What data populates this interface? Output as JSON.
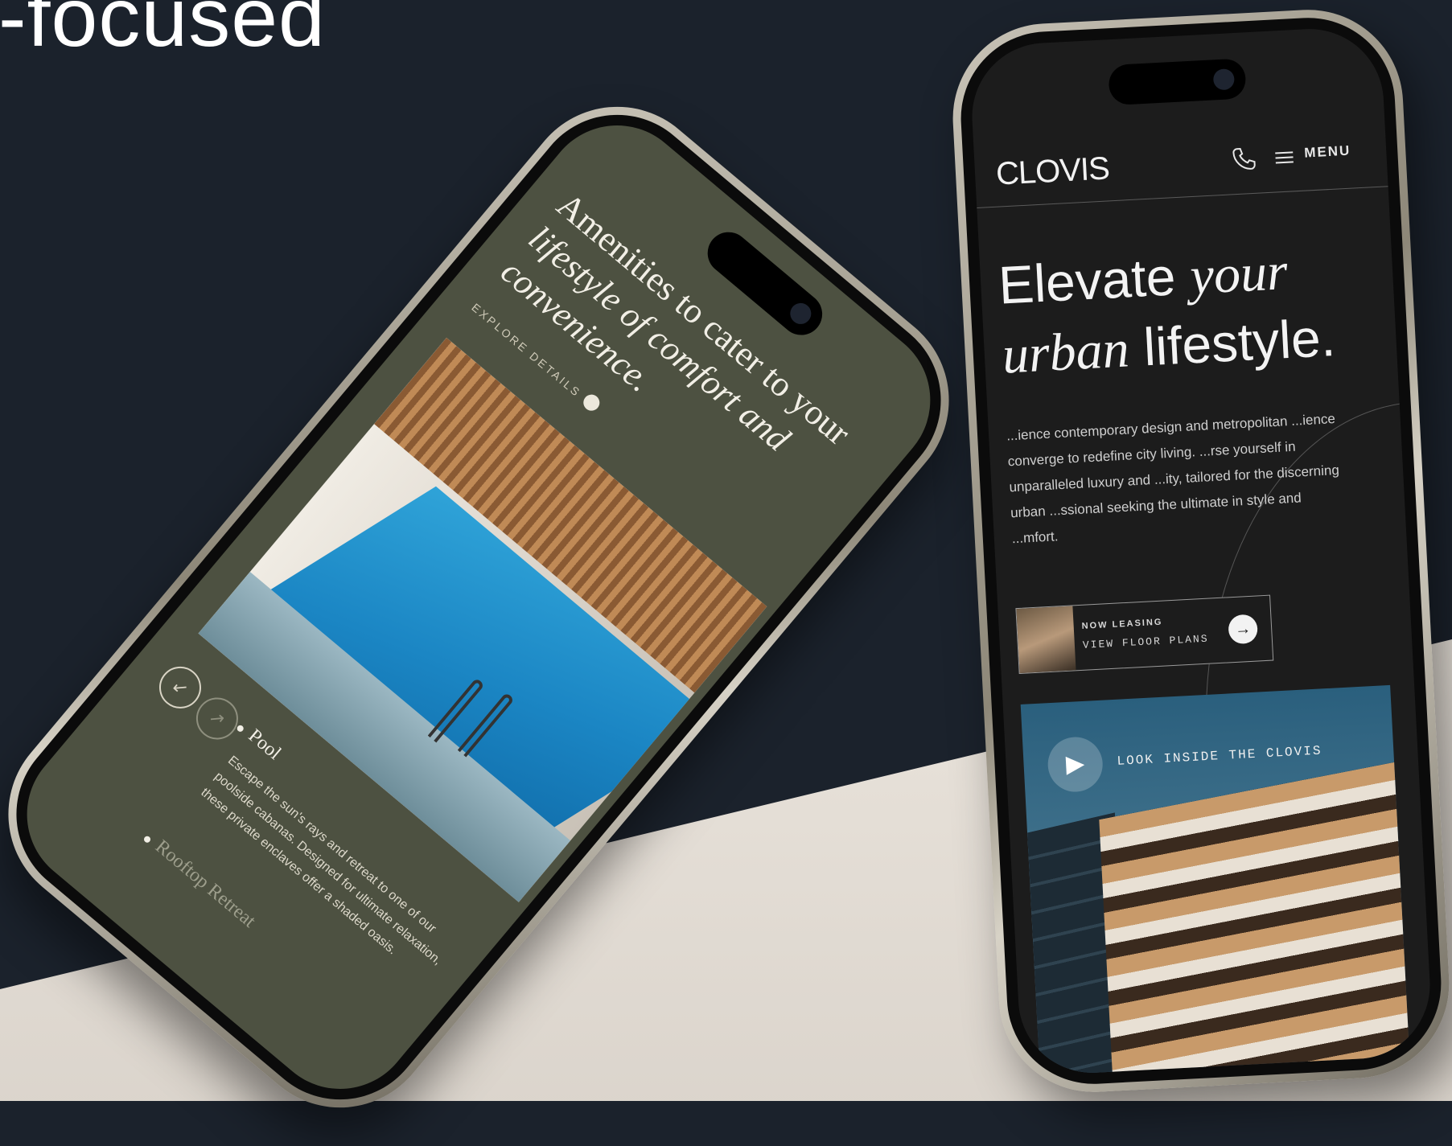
{
  "heading_fragment": "-focused",
  "right_phone": {
    "logo": "CLOVIS",
    "menu_label": "MENU",
    "hero_title": {
      "line1_plain": "Elevate ",
      "line1_italic": "your",
      "line2_italic": "urban",
      "line2_plain": " lifestyle."
    },
    "hero_text": "...ience contemporary design and metropolitan ...ience converge to redefine city living. ...rse yourself in unparalleled luxury and ...ity, tailored for the discerning urban ...ssional seeking the ultimate in style and ...mfort.",
    "cta": {
      "small_label": "NOW LEASING",
      "main_label": "VIEW FLOOR PLANS"
    },
    "video_label": "LOOK INSIDE THE CLOVIS"
  },
  "left_phone": {
    "title": {
      "plain": "Amenities to cater to your",
      "italic": "lifestyle of comfort and convenience."
    },
    "explore_label": "EXPLORE DETAILS",
    "item1_title": "Pool",
    "item1_text": "Escape the sun's rays and retreat to one of our poolside cabanas. Designed for ultimate relaxation, these private enclaves offer a shaded oasis.",
    "item2_title": "Rooftop Retreat"
  },
  "icons": {
    "phone": "phone-icon",
    "menu": "hamburger-menu-icon",
    "arrow": "arrow-right-icon",
    "play": "play-icon",
    "prev": "arrow-down-left-icon",
    "next": "arrow-up-right-icon"
  },
  "colors": {
    "background": "#1b222c",
    "floor": "#e9e3db",
    "right_screen": "#1c1c1c",
    "left_screen": "#4d5141"
  }
}
